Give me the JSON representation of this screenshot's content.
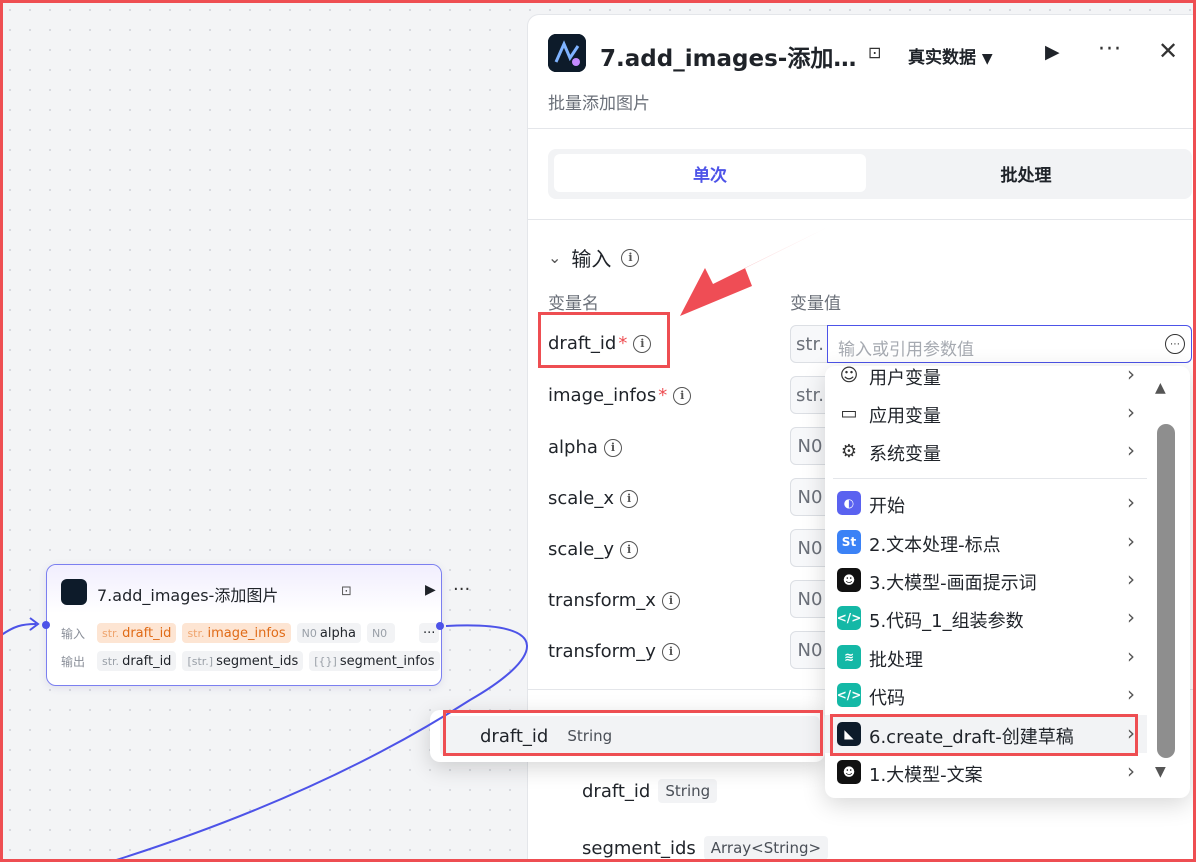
{
  "node": {
    "title": "7.add_images-添加图片",
    "input_label": "输入",
    "output_label": "输出",
    "inputs": [
      {
        "type": "str.",
        "name": "draft_id"
      },
      {
        "type": "str.",
        "name": "image_infos"
      },
      {
        "type": "N0",
        "name": "alpha"
      },
      {
        "type": "N0",
        "name": ""
      }
    ],
    "outputs": [
      {
        "type": "str.",
        "name": "draft_id"
      },
      {
        "type": "[str.]",
        "name": "segment_ids"
      },
      {
        "type": "[{}]",
        "name": "segment_infos"
      }
    ]
  },
  "panel": {
    "title": "7.add_images-添加…",
    "subtitle": "批量添加图片",
    "mode": "真实数据",
    "tabs": [
      {
        "label": "单次"
      },
      {
        "label": "批处理"
      }
    ],
    "section_title": "输入",
    "col_name": "变量名",
    "col_value": "变量值",
    "params": [
      {
        "name": "draft_id",
        "required": "*",
        "type": "str."
      },
      {
        "name": "image_infos",
        "required": "*",
        "type": "str."
      },
      {
        "name": "alpha",
        "required": "",
        "type": "N0"
      },
      {
        "name": "scale_x",
        "required": "",
        "type": "N0"
      },
      {
        "name": "scale_y",
        "required": "",
        "type": "N0"
      },
      {
        "name": "transform_x",
        "required": "",
        "type": "N0"
      },
      {
        "name": "transform_y",
        "required": "",
        "type": "N0"
      }
    ],
    "input_placeholder": "输入或引用参数值",
    "outputs": [
      {
        "name": "draft_id",
        "type": "String"
      },
      {
        "name": "segment_ids",
        "type": "Array<String>"
      }
    ]
  },
  "dropdown": {
    "items": [
      {
        "label": "用户变量",
        "icon": "user-icon"
      },
      {
        "label": "应用变量",
        "icon": "folder-icon"
      },
      {
        "label": "系统变量",
        "icon": "gear-icon"
      },
      {
        "label": "开始",
        "icon": "start-icon"
      },
      {
        "label": "2.文本处理-标点",
        "icon": "text-process-icon"
      },
      {
        "label": "3.大模型-画面提示词",
        "icon": "llm-icon"
      },
      {
        "label": "5.代码_1_组装参数",
        "icon": "code-icon"
      },
      {
        "label": "批处理",
        "icon": "batch-icon"
      },
      {
        "label": "代码",
        "icon": "code-icon"
      },
      {
        "label": "6.create_draft-创建草稿",
        "icon": "plugin-icon"
      },
      {
        "label": "1.大模型-文案",
        "icon": "llm-icon"
      }
    ]
  },
  "submenu": {
    "name": "draft_id",
    "type": "String"
  },
  "colors": {
    "accent": "#4d53e8",
    "highlight": "#ee4e52",
    "warn": "#e06b17"
  }
}
